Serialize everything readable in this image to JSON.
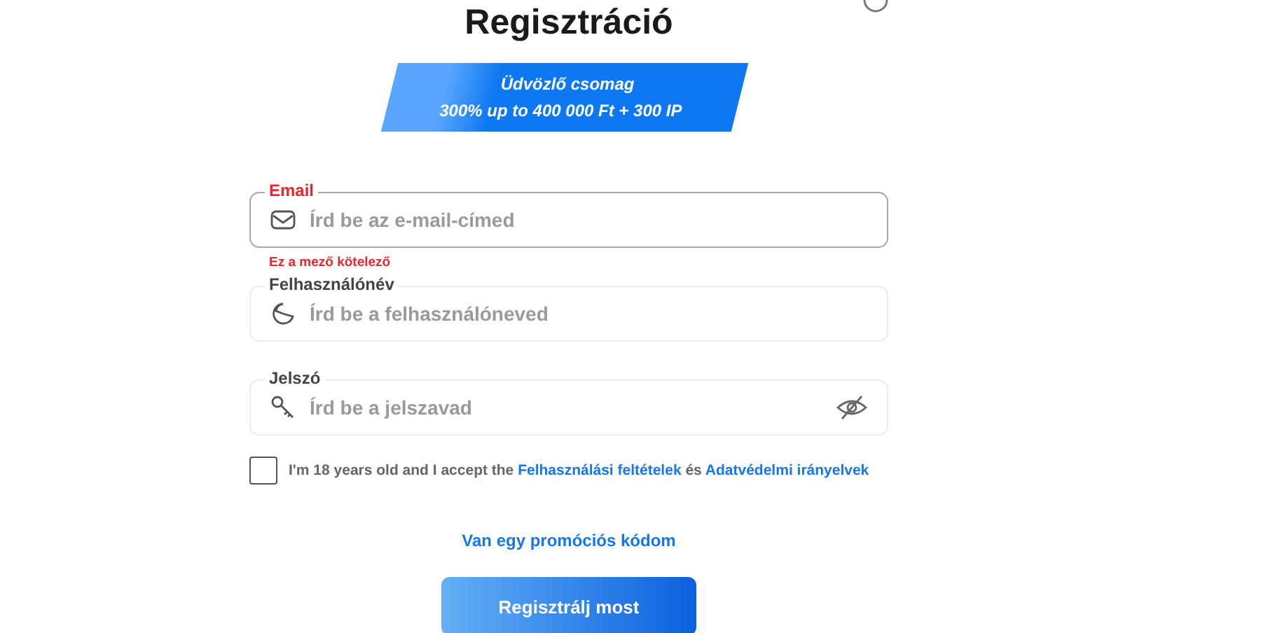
{
  "title": "Regisztráció",
  "banner": {
    "line_1": "Üdvözlő csomag",
    "line_2": "300% up to 400 000 Ft + 300 IP"
  },
  "fields": [
    {
      "kind": "email",
      "label": "Email",
      "placeholder": "Írd be az e-mail-címed",
      "error": true,
      "error_text": "Ez a mező kötelező"
    },
    {
      "kind": "user",
      "label": "Felhasználónév",
      "placeholder": "Írd be a felhasználóneved",
      "error": false
    },
    {
      "kind": "password",
      "label": "Jelszó",
      "placeholder": "Írd be a jelszavad",
      "error": false
    }
  ],
  "consent": {
    "checked": false,
    "text": "I'm 18 years old and I accept the",
    "link_1": "Felhasználási feltételek",
    "joiner": "és",
    "link_2": "Adatvédelmi irányelvek"
  },
  "promo_link": "Van egy promóciós kódom",
  "submit": "Regisztrálj most"
}
